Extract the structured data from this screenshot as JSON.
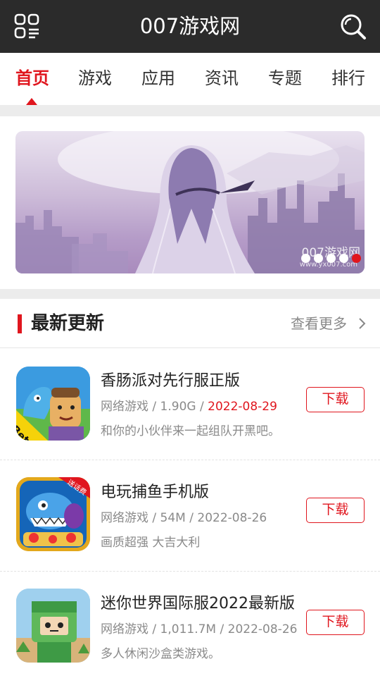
{
  "header": {
    "title": "007游戏网",
    "menu_icon": "grid-menu-icon",
    "search_icon": "search-icon"
  },
  "tabs": [
    {
      "label": "首页",
      "active": true
    },
    {
      "label": "游戏",
      "active": false
    },
    {
      "label": "应用",
      "active": false
    },
    {
      "label": "资讯",
      "active": false
    },
    {
      "label": "专题",
      "active": false
    },
    {
      "label": "排行",
      "active": false
    }
  ],
  "banner": {
    "watermark": "007游戏网",
    "watermark_url": "www.yx007.com",
    "slide_count": 5,
    "active_slide": 5
  },
  "latest": {
    "title": "最新更新",
    "more_label": "查看更多",
    "items": [
      {
        "name": "香肠派对先行服正版",
        "category": "网络游戏",
        "size": "1.90G",
        "date": "2022-08-29",
        "date_highlight": true,
        "desc": "和你的小伙伴来一起组队开黑吧。",
        "button": "下载",
        "icon_badge": "Beta"
      },
      {
        "name": "电玩捕鱼手机版",
        "category": "网络游戏",
        "size": "54M",
        "date": "2022-08-26",
        "date_highlight": false,
        "desc": "画质超强 大吉大利",
        "button": "下载",
        "icon_badge": "送话费"
      },
      {
        "name": "迷你世界国际服2022最新版",
        "category": "网络游戏",
        "size": "1,011.7M",
        "date": "2022-08-26",
        "date_highlight": false,
        "desc": "多人休闲沙盒类游戏。",
        "button": "下载",
        "icon_badge": ""
      }
    ]
  },
  "colors": {
    "header_bg": "#2b2b2b",
    "accent": "#e0161e",
    "muted_text": "#8a8a8a"
  }
}
